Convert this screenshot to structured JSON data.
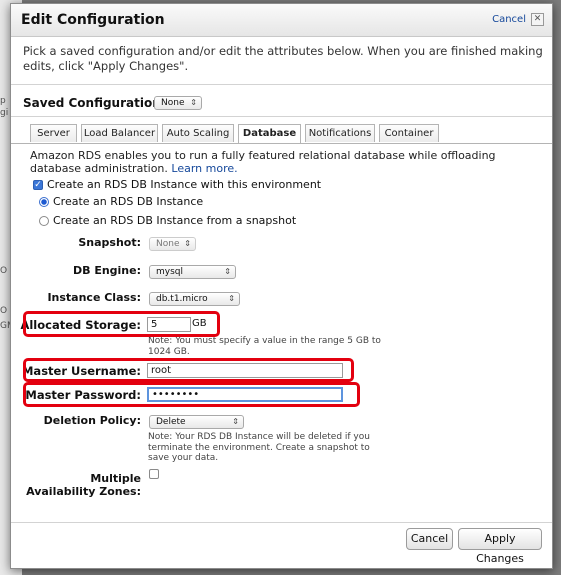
{
  "background": {
    "fragments": [
      "p",
      "gi",
      "O",
      "O",
      "GM"
    ]
  },
  "dialog": {
    "title": "Edit Configuration",
    "cancel_link": "Cancel",
    "close_glyph": "✕",
    "intro": "Pick a saved configuration and/or edit the attributes below. When you are finished making edits, click \"Apply Changes\"."
  },
  "saved_configurations": {
    "label": "Saved Configurations:",
    "value": "None"
  },
  "tabs": [
    "Server",
    "Load Balancer",
    "Auto Scaling",
    "Database",
    "Notifications",
    "Container"
  ],
  "active_tab": "Database",
  "database": {
    "description": "Amazon RDS enables you to run a fully featured relational database while offloading database administration.",
    "learn_more": "Learn more.",
    "create_checkbox_label": "Create an RDS DB Instance with this environment",
    "create_checked": true,
    "radio_new": "Create an RDS DB Instance",
    "radio_snapshot": "Create an RDS DB Instance from a snapshot",
    "selected_radio": "Create an RDS DB Instance",
    "snapshot": {
      "label": "Snapshot:",
      "value": "None"
    },
    "engine": {
      "label": "DB Engine:",
      "value": "mysql"
    },
    "instance_class": {
      "label": "Instance Class:",
      "value": "db.t1.micro"
    },
    "storage": {
      "label": "Allocated Storage:",
      "value": "5",
      "unit": "GB",
      "note": "Note: You must specify a value in the range 5 GB to 1024 GB."
    },
    "username": {
      "label": "Master Username:",
      "value": "root"
    },
    "password": {
      "label": "Master Password:",
      "value": "••••••••"
    },
    "deletion": {
      "label": "Deletion Policy:",
      "value": "Delete",
      "note": "Note: Your RDS DB Instance will be deleted if you terminate the environment. Create a snapshot to save your data."
    },
    "multi_az": {
      "label_line1": "Multiple",
      "label_line2": "Availability Zones:",
      "checked": false
    }
  },
  "buttons": {
    "cancel": "Cancel",
    "apply": "Apply Changes"
  },
  "colors": {
    "highlight": "#e3000f",
    "link": "#14479a",
    "focus": "#5d94de"
  }
}
